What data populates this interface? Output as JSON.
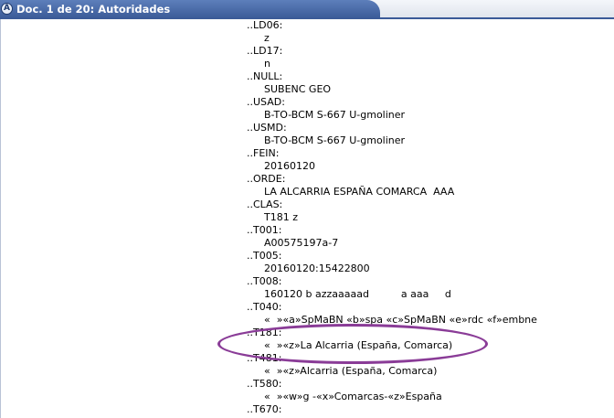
{
  "header": {
    "title": "Doc. 1 de 20: Autoridades"
  },
  "records": [
    {
      "tag": "..LD06:",
      "value": "z"
    },
    {
      "tag": "..LD17:",
      "value": "n"
    },
    {
      "tag": "..NULL:",
      "value": "SUBENC GEO"
    },
    {
      "tag": "..USAD:",
      "value": "B-TO-BCM S-667 U-gmoliner"
    },
    {
      "tag": "..USMD:",
      "value": "B-TO-BCM S-667 U-gmoliner"
    },
    {
      "tag": "..FEIN:",
      "value": "20160120"
    },
    {
      "tag": "..ORDE:",
      "value": "LA ALCARRIA ESPAÑA COMARCA  AAA"
    },
    {
      "tag": "..CLAS:",
      "value": "T181 z"
    },
    {
      "tag": "..T001:",
      "value": "A00575197a-7"
    },
    {
      "tag": "..T005:",
      "value": "20160120:15422800"
    },
    {
      "tag": "..T008:",
      "value": "160120 b azzaaaaad          a aaa     d"
    },
    {
      "tag": "..T040:",
      "value": "«  »«a»SpMaBN «b»spa «c»SpMaBN «e»rdc «f»embne"
    },
    {
      "tag": "..T181:",
      "value": "«  »«z»La Alcarria (España, Comarca)"
    },
    {
      "tag": "..T481:",
      "value": "«  »«z»Alcarria (España, Comarca)"
    },
    {
      "tag": "..T580:",
      "value": "«  »«w»g -«x»Comarcas-«z»España"
    },
    {
      "tag": "..T670:",
      "value": ""
    }
  ]
}
